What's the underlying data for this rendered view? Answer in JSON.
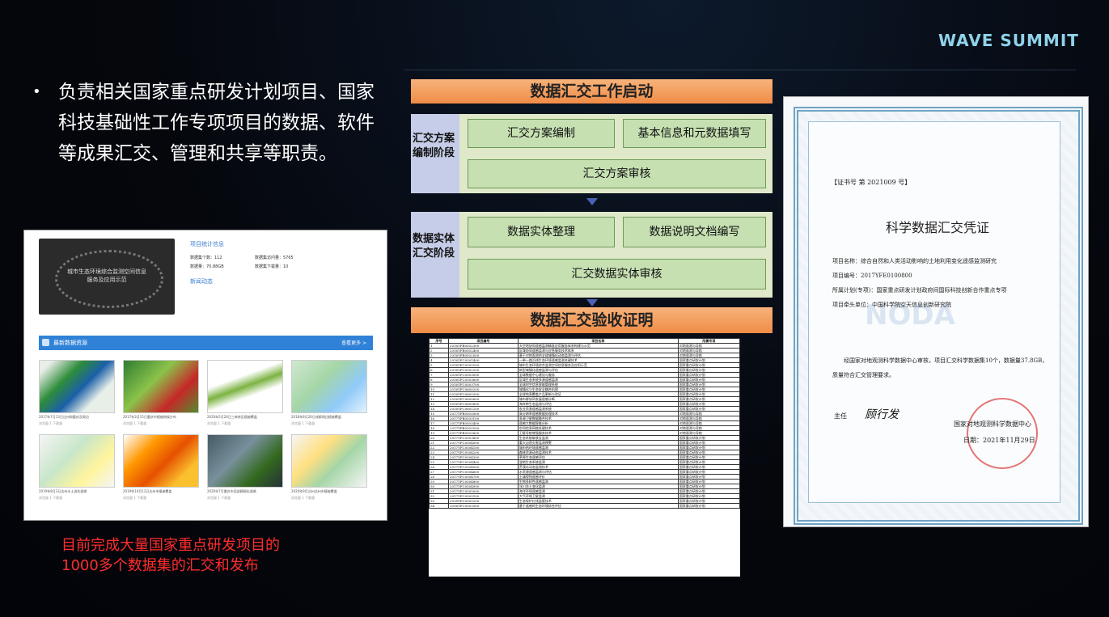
{
  "brand": "WAVE SUMMIT",
  "bullet": {
    "marker": "•",
    "text": "负责相关国家重点研发计划项目、国家科技基础性工作专项项目的数据、软件等成果汇交、管理和共享等职责。"
  },
  "caption_line1": "目前完成大量国家重点研发项目的",
  "caption_line2": "1000多个数据集的汇交和发布",
  "portal": {
    "hero_text_1": "城市生态环境综合监测空间信息",
    "hero_text_2": "服务及应用示范",
    "stats_title": "项目统计信息",
    "stats": [
      "数据集个数：112",
      "数据量：70.88GB",
      "数据集访问量：5765",
      "数据集下载量：10"
    ],
    "news_link": "新闻动态",
    "resources_title": "最新数据资源",
    "more_label": "查看更多 >",
    "thumb_captions": [
      "2017年7月13日达州和重庆及周边",
      "2017年3月15日重庆市植被物候分布",
      "2020年5月26日三峡库区植被覆盖",
      "2018年8月26日成都周边植被覆盖",
      "2019年8月3日达州水土流失遥感",
      "2019年10月12日达州市植被覆盖",
      "2020年7月重庆市局部精细化遥感",
      "2020年9月达州达州市植被覆盖"
    ],
    "thumb_meta": "浏览量 1   下载量"
  },
  "flow": {
    "start": "数据汇交工作启动",
    "stage1_label": "汇交方案编制阶段",
    "s1_box1": "汇交方案编制",
    "s1_box2": "基本信息和元数据填写",
    "s1_box3": "汇交方案审核",
    "stage2_label": "数据实体汇交阶段",
    "s2_box1": "数据实体整理",
    "s2_box2": "数据说明文档编写",
    "s2_box3": "汇交数据实体审核",
    "end": "数据汇交验收证明"
  },
  "table": {
    "headers": [
      "序号",
      "项目编号",
      "项目名称",
      "所属专项"
    ],
    "rows": [
      [
        "1",
        "2016YFB0502300",
        "天空地协同遥感监测精准应用服务体系构建与示范",
        "对地观测与导航"
      ],
      [
        "2",
        "2016YFB0502400",
        "区域协同遥感监测与应急服务技术体系",
        "对地观测与导航"
      ],
      [
        "3",
        "2016YFB0502500",
        "基于对地观测的全球城镇化动态监测与评估",
        "对地观测与导航"
      ],
      [
        "4",
        "2016YFC0501400",
        "一带一路沿线生态环境遥感监测关键技术",
        "国家重点研发计划"
      ],
      [
        "5",
        "2016YFC0502100",
        "城市生态环境综合监测空间信息服务及应用示范",
        "国家重点研发计划"
      ],
      [
        "6",
        "2016YFC0502200",
        "新型城镇化遥感监测与评估",
        "国家重点研发计划"
      ],
      [
        "7",
        "2016YFC0503000",
        "全球数据中心建设与服务",
        "国家重点研发计划"
      ],
      [
        "8",
        "2016YFC0503600",
        "区域生态系统多源遥感监测",
        "国家重点研发计划"
      ],
      [
        "9",
        "2016YFC0503700",
        "全球时空信息智能管理系统",
        "国家重点研发计划"
      ],
      [
        "10",
        "2016YFC0600200",
        "城镇化与生态安全耦合机理",
        "国家重点研发计划"
      ],
      [
        "11",
        "2016YFC0600300",
        "全球地表覆盖产品更新与验证",
        "国家重点研发计划"
      ],
      [
        "12",
        "2016YFC0600600",
        "城市群协同发展遥感诊断",
        "国家重点研发计划"
      ],
      [
        "13",
        "2016YFC0600800",
        "海岸带生态监测与评估",
        "国家重点研发计划"
      ],
      [
        "14",
        "2016YFC0601200",
        "农业资源遥感监测系统",
        "国家重点研发计划"
      ],
      [
        "15",
        "2017YFB0503000",
        "高分辨率遥感数据处理技术",
        "对地观测与导航"
      ],
      [
        "16",
        "2017YFB0503100",
        "多源卫星数据融合技术",
        "对地观测与导航"
      ],
      [
        "17",
        "2017YFB0503400",
        "遥感大数据智能分析",
        "对地观测与导航"
      ],
      [
        "18",
        "2017YFB0503500",
        "空间信息网络关键技术",
        "对地观测与导航"
      ],
      [
        "19",
        "2017YFB0503600",
        "卫星导航增强服务技术",
        "对地观测与导航"
      ],
      [
        "20",
        "2017YFC0503800",
        "生态系统碳收支监测",
        "国家重点研发计划"
      ],
      [
        "21",
        "2017YFC0504000",
        "重大自然灾害监测预警",
        "国家重点研发计划"
      ],
      [
        "22",
        "2017YFC0504100",
        "城市热环境遥感监测",
        "国家重点研发计划"
      ],
      [
        "23",
        "2017YFC0504200",
        "森林资源动态监测技术",
        "国家重点研发计划"
      ],
      [
        "24",
        "2017YFC0504300",
        "草原生态遥感评估",
        "国家重点研发计划"
      ],
      [
        "25",
        "2017YFC0504400",
        "湿地生态系统监测",
        "国家重点研发计划"
      ],
      [
        "26",
        "2017YFC0504500",
        "荒漠化动态监测技术",
        "国家重点研发计划"
      ],
      [
        "27",
        "2017YFC0504600",
        "水资源遥感监测与评估",
        "国家重点研发计划"
      ],
      [
        "28",
        "2017YFC0504700",
        "土壤侵蚀遥感评价",
        "国家重点研发计划"
      ],
      [
        "29",
        "2017YFC0504800",
        "生物多样性遥感监测",
        "国家重点研发计划"
      ],
      [
        "30",
        "2017YFC0504900",
        "冰川冻土变化监测",
        "国家重点研发计划"
      ],
      [
        "31",
        "2017YFC0505000",
        "海洋环境遥感监测",
        "国家重点研发计划"
      ],
      [
        "32",
        "2017YFC0505100",
        "大气环境卫星监测",
        "国家重点研发计划"
      ],
      [
        "33",
        "2018YFC0505200",
        "生态保护红线监管技术",
        "国家重点研发计划"
      ],
      [
        "34",
        "2016YFC0503300",
        "基于遥感的生态环境综合评估",
        "国家重点研发计划"
      ]
    ]
  },
  "certificate": {
    "number": "【证书号 第 2021009 号】",
    "title": "科学数据汇交凭证",
    "item_name": "项目名称：综合自然和人类活动影响的土地利用变化遥感监测研究",
    "item_no": "项目编号：2017YFE0100800",
    "item_plan": "所属计划(专项)：国家重点研发计划政府间国际科技创新合作重点专项",
    "item_unit": "项目牵头单位：中国科学院空天信息创新研究院",
    "body": "经国家对地观测科学数据中心审核，项目汇交科学数据集10个，数据量37.8GB，质量符合汇交管理要求。",
    "director_label": "主任",
    "signature": "顾行发",
    "org": "国家对地观测科学数据中心",
    "date": "日期：2021年11月29日",
    "watermark": "NODA"
  },
  "colors": {
    "flow_orange": "#f08c47",
    "stage_blue": "#c6cde8",
    "box_green": "#c6e0b2",
    "caption_red": "#ff2d2d",
    "brand_cyan": "#8fd3ea"
  }
}
